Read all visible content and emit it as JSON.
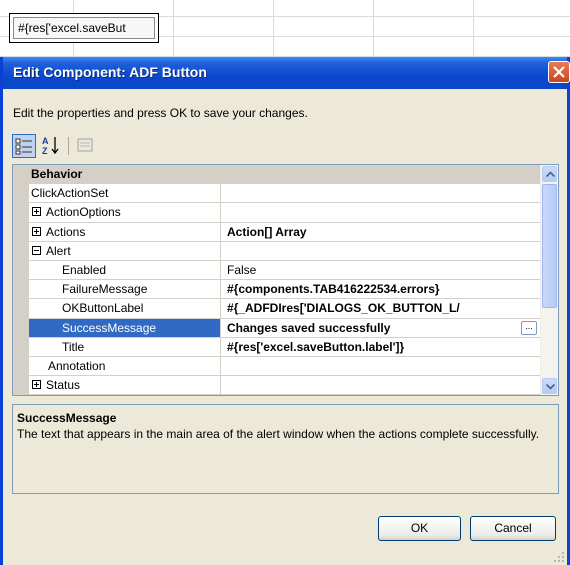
{
  "background": {
    "cell_button_label": "#{res['excel.saveBut"
  },
  "dialog": {
    "title": "Edit Component: ADF Button",
    "instructions": "Edit the properties and press OK to save your changes.",
    "toolbar": {
      "categorized_icon": "categorized-icon",
      "alphabetical_icon": "sort-az-icon",
      "pages_icon": "property-pages-icon"
    },
    "grid": {
      "rows": [
        {
          "name": "Behavior",
          "value": "",
          "kind": "category",
          "expander": "minus"
        },
        {
          "name": "ClickActionSet",
          "value": "",
          "expander": "minus",
          "indent": 0
        },
        {
          "name": "ActionOptions",
          "value": "",
          "expander": "plus",
          "indent": 1
        },
        {
          "name": "Actions",
          "value": "Action[] Array",
          "expander": "plus",
          "indent": 1
        },
        {
          "name": "Alert",
          "value": "",
          "expander": "minus",
          "indent": 1
        },
        {
          "name": "Enabled",
          "value": "False",
          "indent": 2,
          "plain": true
        },
        {
          "name": "FailureMessage",
          "value": "#{components.TAB416222534.errors}",
          "indent": 2
        },
        {
          "name": "OKButtonLabel",
          "value": "#{_ADFDIres['DIALOGS_OK_BUTTON_L/",
          "indent": 2
        },
        {
          "name": "SuccessMessage",
          "value": "Changes saved successfully",
          "indent": 2,
          "selected": true,
          "ellipsis": "..."
        },
        {
          "name": "Title",
          "value": "#{res['excel.saveButton.label']}",
          "indent": 2
        },
        {
          "name": "Annotation",
          "value": "",
          "indent": 1
        },
        {
          "name": "Status",
          "value": "",
          "expander": "plus",
          "indent": 1
        }
      ]
    },
    "description": {
      "title": "SuccessMessage",
      "text": "The text that appears in the main area of the alert window when the actions complete successfully."
    },
    "buttons": {
      "ok": "OK",
      "cancel": "Cancel"
    }
  }
}
